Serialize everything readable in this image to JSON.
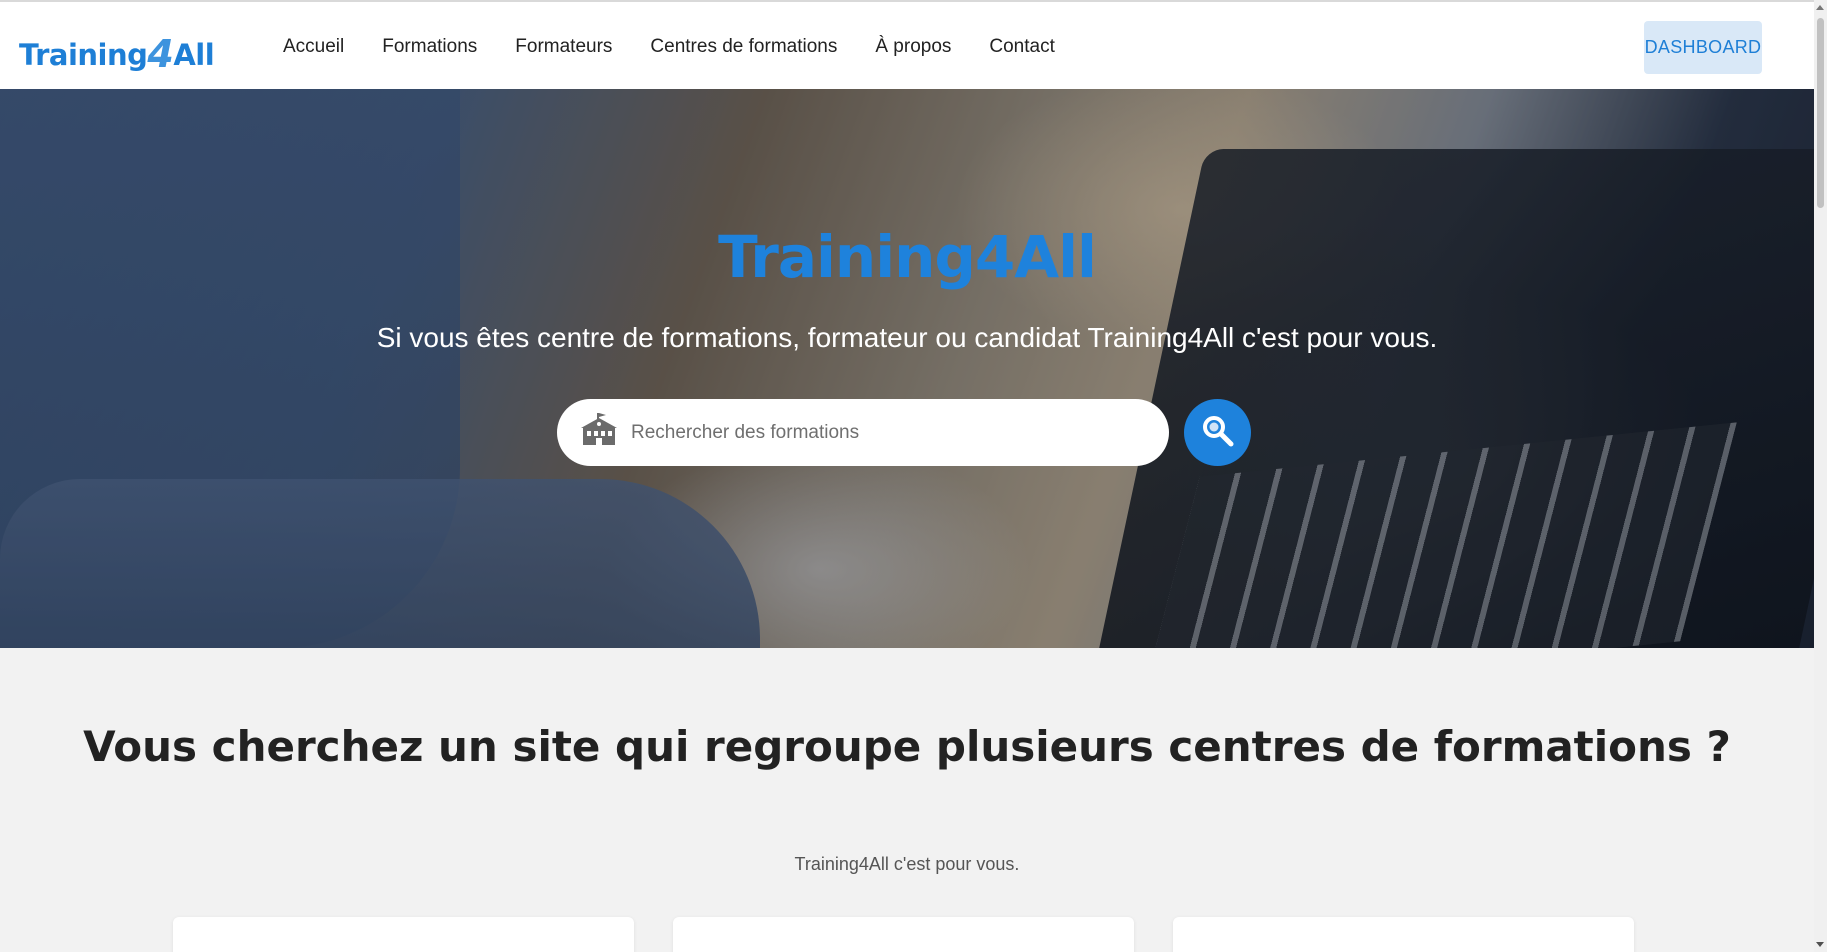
{
  "brand": {
    "prefix": "Training",
    "number": "4",
    "suffix": "All"
  },
  "nav": {
    "links": [
      "Accueil",
      "Formations",
      "Formateurs",
      "Centres de formations",
      "À propos",
      "Contact"
    ],
    "dashboard_label": "DASHBOARD"
  },
  "hero": {
    "title": "Training4All",
    "subtitle": "Si vous êtes centre de formations, formateur ou candidat Training4All c'est pour vous.",
    "search_placeholder": "Rechercher des formations"
  },
  "section": {
    "title": "Vous cherchez un site qui regroupe plusieurs centres de formations ?",
    "subtitle": "Training4All c'est pour vous."
  },
  "colors": {
    "accent": "#1e82dc",
    "dashboard_bg": "#d9e8f7",
    "page_bg": "#f2f2f2"
  }
}
